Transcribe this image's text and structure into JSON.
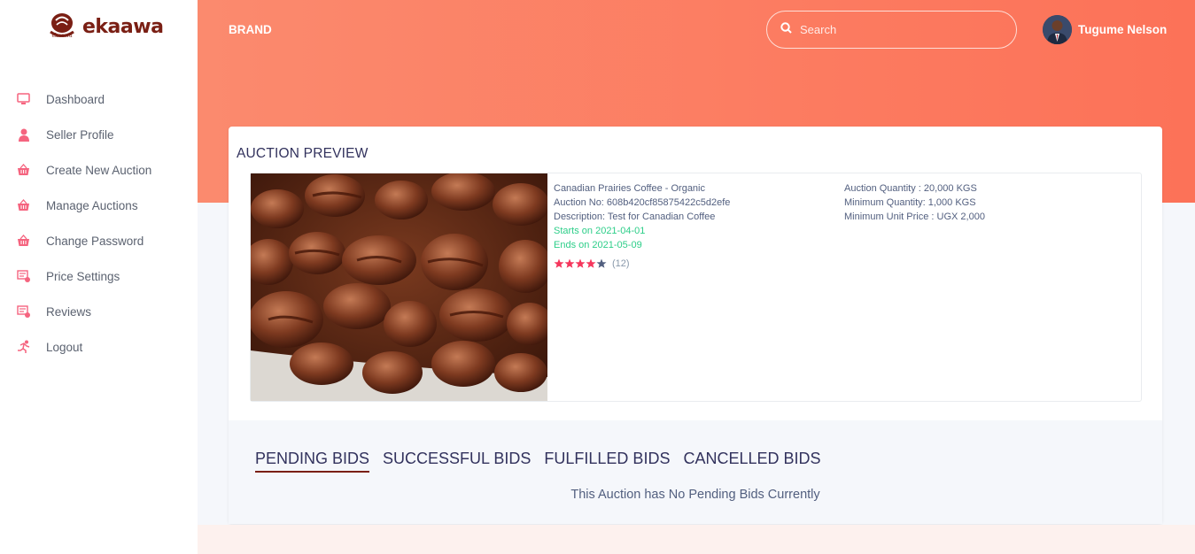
{
  "logo": {
    "text": "ekaawa"
  },
  "sidebar": {
    "items": [
      {
        "label": "Dashboard",
        "icon": "monitor-icon"
      },
      {
        "label": "Seller Profile",
        "icon": "user-icon"
      },
      {
        "label": "Create New Auction",
        "icon": "basket-icon"
      },
      {
        "label": "Manage Auctions",
        "icon": "basket-icon"
      },
      {
        "label": "Change Password",
        "icon": "basket-icon"
      },
      {
        "label": "Price Settings",
        "icon": "settings-icon"
      },
      {
        "label": "Reviews",
        "icon": "settings-icon"
      },
      {
        "label": "Logout",
        "icon": "running-person-icon"
      }
    ]
  },
  "header": {
    "brand": "BRAND",
    "search_placeholder": "Search",
    "user_name": "Tugume Nelson"
  },
  "auction": {
    "section_title": "AUCTION PREVIEW",
    "product_name": "Canadian Prairies Coffee - Organic",
    "auction_no": "Auction No: 608b420cf85875422c5d2efe",
    "description": "Description: Test for Canadian Coffee",
    "starts": "Starts on 2021-04-01",
    "ends": "Ends on 2021-05-09",
    "rating": 4,
    "rating_max": 5,
    "review_count": "(12)",
    "quantity": "Auction Quantity : 20,000 KGS",
    "min_quantity": "Minimum Quantity: 1,000 KGS",
    "min_unit_price": "Minimum Unit Price : UGX 2,000"
  },
  "bids": {
    "tabs": [
      "PENDING BIDS",
      "SUCCESSFUL BIDS",
      "FULFILLED BIDS",
      "CANCELLED BIDS"
    ],
    "active_tab": "PENDING BIDS",
    "empty_message": "This Auction has No Pending Bids Currently"
  },
  "colors": {
    "accent": "#fc7258",
    "brand_dark": "#7a1f14",
    "success": "#2dce89",
    "icon_pink": "#f5647f"
  }
}
